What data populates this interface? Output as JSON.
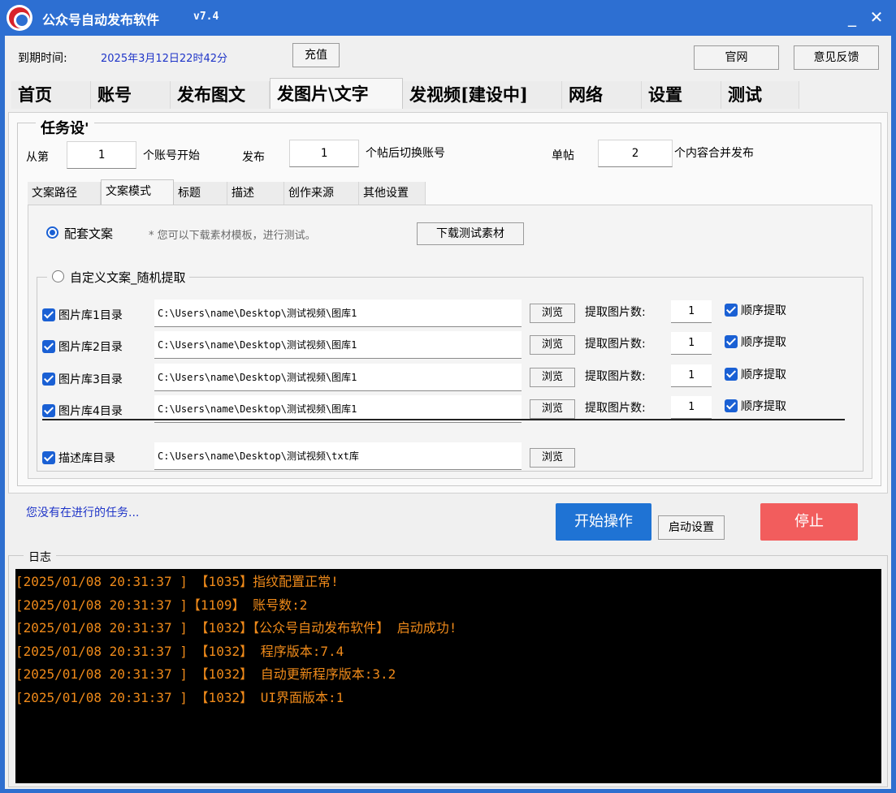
{
  "window": {
    "title": "公众号自动发布软件",
    "version": "v7.4",
    "minimize": "_",
    "close": "✕"
  },
  "header": {
    "expire_label": "到期时间:",
    "expire_value": "2025年3月12日22时42分",
    "recharge": "充值",
    "official_site": "官网",
    "feedback": "意见反馈"
  },
  "tabs": [
    {
      "label": "首页"
    },
    {
      "label": "账号"
    },
    {
      "label": "发布图文"
    },
    {
      "label": "发图片\\文字",
      "active": true
    },
    {
      "label": "发视频[建设中]"
    },
    {
      "label": "网络"
    },
    {
      "label": "设置"
    },
    {
      "label": "测试"
    }
  ],
  "task": {
    "legend": "任务设'",
    "from_label": "从第",
    "from_value": "1",
    "from_suffix": "个账号开始",
    "publish_label": "发布",
    "publish_value": "1",
    "publish_suffix": "个帖后切换账号",
    "single_label": "单帖",
    "single_value": "2",
    "single_suffix": "个内容合并发布"
  },
  "subtabs": [
    {
      "label": "文案路径"
    },
    {
      "label": "文案模式",
      "active": true
    },
    {
      "label": "标题"
    },
    {
      "label": "描述"
    },
    {
      "label": "创作来源"
    },
    {
      "label": "其他设置"
    }
  ],
  "mode": {
    "preset_label": "配套文案",
    "preset_selected": true,
    "hint": "* 您可以下载素材模板，进行测试。",
    "download_button": "下载测试素材",
    "custom_label": "自定义文案_随机提取",
    "custom_selected": false
  },
  "libraries": [
    {
      "label": "图片库1目录",
      "checked": true,
      "path": "C:\\Users\\name\\Desktop\\测试视频\\图库1",
      "browse": "浏览",
      "count_label": "提取图片数:",
      "count": "1",
      "order_label": "顺序提取",
      "order_checked": true
    },
    {
      "label": "图片库2目录",
      "checked": true,
      "path": "C:\\Users\\name\\Desktop\\测试视频\\图库1",
      "browse": "浏览",
      "count_label": "提取图片数:",
      "count": "1",
      "order_label": "顺序提取",
      "order_checked": true
    },
    {
      "label": "图片库3目录",
      "checked": true,
      "path": "C:\\Users\\name\\Desktop\\测试视频\\图库1",
      "browse": "浏览",
      "count_label": "提取图片数:",
      "count": "1",
      "order_label": "顺序提取",
      "order_checked": true
    },
    {
      "label": "图片库4目录",
      "checked": true,
      "path": "C:\\Users\\name\\Desktop\\测试视频\\图库1",
      "browse": "浏览",
      "count_label": "提取图片数:",
      "count": "1",
      "order_label": "顺序提取",
      "order_checked": true
    }
  ],
  "desc_library": {
    "label": "描述库目录",
    "checked": true,
    "path": "C:\\Users\\name\\Desktop\\测试视频\\txt库",
    "browse": "浏览"
  },
  "status": {
    "text": "您没有在进行的任务...",
    "start_button": "开始操作",
    "start_settings_button": "启动设置",
    "stop_button": "停止"
  },
  "log": {
    "legend": "日志",
    "lines": [
      "[2025/01/08 20:31:37 ] 【1035】指纹配置正常!",
      "[2025/01/08 20:31:37 ]【1109】 账号数:2",
      "[2025/01/08 20:31:37 ] 【1032】【公众号自动发布软件】 启动成功!",
      "[2025/01/08 20:31:37 ] 【1032】 程序版本:7.4",
      "[2025/01/08 20:31:37 ] 【1032】 自动更新程序版本:3.2",
      "[2025/01/08 20:31:37 ] 【1032】 UI界面版本:1"
    ]
  },
  "colors": {
    "titlebar": "#2d6fd2",
    "link_blue": "#1f35c8",
    "start_button": "#1f73d4",
    "stop_button": "#f25d5d",
    "log_text": "#ef8a1a",
    "checkbox": "#1a60d4"
  }
}
